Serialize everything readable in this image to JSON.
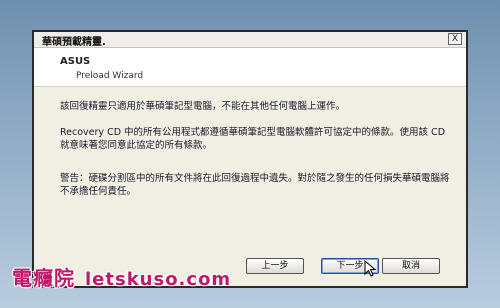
{
  "window": {
    "title": "華碩預載精靈.",
    "close_label": "X"
  },
  "header": {
    "brand": "ASUS",
    "wizard_name": "Preload Wizard"
  },
  "content": {
    "paragraph1": "該回復精靈只適用於華碩筆記型電腦，不能在其他任何電腦上運作。",
    "paragraph2": "Recovery CD 中的所有公用程式都遵循華碩筆記型電腦軟體許可協定中的條款。使用該 CD 就意味著您同意此協定的所有條款。",
    "paragraph3": "警告：硬碟分割區中的所有文件將在此回復過程中遺失。對於隨之發生的任何損失華碩電腦將不承擔任何責任。"
  },
  "buttons": {
    "back": "上一步",
    "next": "下一步",
    "cancel": "取消"
  },
  "watermark": {
    "name": "電癮院",
    "site": "letskuso.com"
  },
  "icons": {
    "cursor": "mouse-pointer-icon"
  }
}
